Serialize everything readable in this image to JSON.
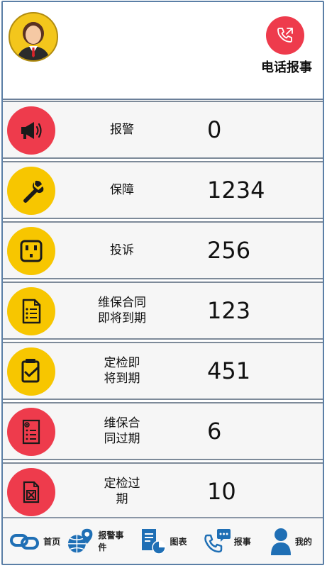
{
  "header": {
    "phone_label": "电话报事"
  },
  "rows": [
    {
      "label": "报警",
      "value": "0",
      "icon": "megaphone-icon",
      "color": "#ee3b4c"
    },
    {
      "label": "保障",
      "value": "1234",
      "icon": "wrench-icon",
      "color": "#f7c600"
    },
    {
      "label": "投诉",
      "value": "256",
      "icon": "sad-face-icon",
      "color": "#f7c600"
    },
    {
      "label": "维保合同\n即将到期",
      "value": "123",
      "icon": "checklist-document-icon",
      "color": "#f7c600"
    },
    {
      "label": "定检即\n将到期",
      "value": "451",
      "icon": "checked-document-icon",
      "color": "#f7c600"
    },
    {
      "label": "维保合\n同过期",
      "value": "6",
      "icon": "expired-document-icon",
      "color": "#ee3b4c"
    },
    {
      "label": "定检过\n期",
      "value": "10",
      "icon": "expired-inspection-icon",
      "color": "#ee3b4c"
    }
  ],
  "nav": [
    {
      "label": "首页",
      "icon": "link-chain-icon"
    },
    {
      "label": "报警事件",
      "icon": "globe-pin-icon"
    },
    {
      "label": "图表",
      "icon": "report-chart-icon"
    },
    {
      "label": "报事",
      "icon": "phone-chat-icon"
    },
    {
      "label": "我的",
      "icon": "person-icon"
    }
  ],
  "colors": {
    "red": "#ee3b4c",
    "yellow": "#f7c600",
    "nav_blue": "#1f6fb5"
  }
}
